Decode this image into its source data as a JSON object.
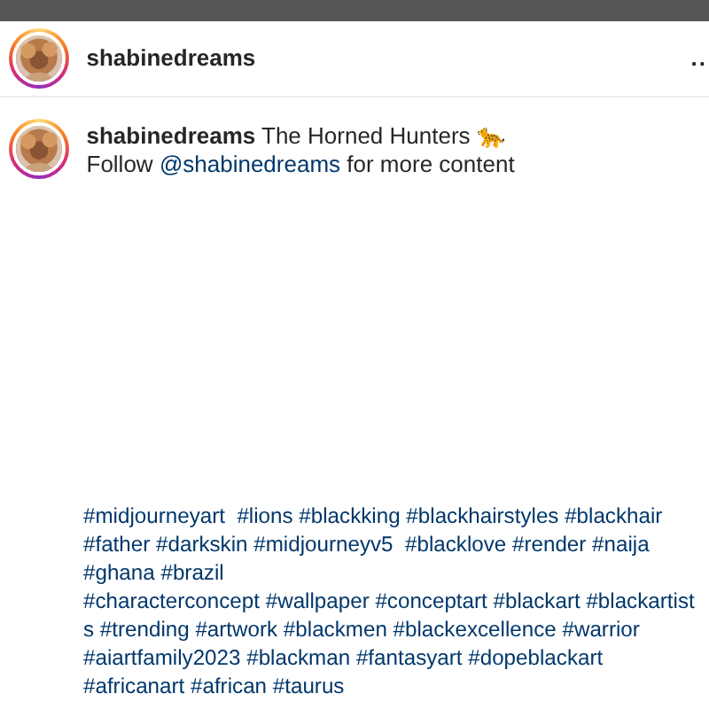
{
  "header": {
    "username": "shabinedreams",
    "more": ".."
  },
  "caption": {
    "username": "shabinedreams",
    "title": "The Horned Hunters 🐆",
    "follow_before": "Follow ",
    "mention": "@shabinedreams",
    "follow_after": " for more content"
  },
  "hashtag_lines": [
    "#midjourneyart  #lions #blackking #blackhairstyles #blackhair",
    "#father #darkskin #midjourneyv5  #blacklove #render #naija",
    "#ghana #brazil",
    "#characterconcept #wallpaper #conceptart #blackart #blackartist",
    "s #trending #artwork #blackmen #blackexcellence #warrior",
    "#aiartfamily2023 #blackman #fantasyart #dopeblackart",
    "#africanart #african #taurus"
  ]
}
